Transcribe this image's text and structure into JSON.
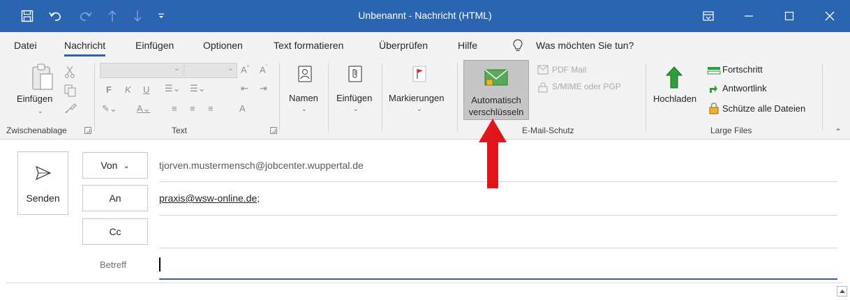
{
  "window": {
    "title": "Unbenannt - Nachricht (HTML)",
    "accent_color": "#2b64b0"
  },
  "quick_access": {
    "icons": [
      "save-icon",
      "undo-icon",
      "redo-icon",
      "up-icon",
      "down-icon",
      "customize-icon"
    ]
  },
  "tabs": {
    "items": [
      "Datei",
      "Nachricht",
      "Einfügen",
      "Optionen",
      "Text formatieren",
      "Überprüfen",
      "Hilfe"
    ],
    "active": "Nachricht",
    "tell_me": "Was möchten Sie tun?"
  },
  "ribbon": {
    "clipboard": {
      "paste_label": "Einfügen",
      "group_label": "Zwischenablage"
    },
    "text": {
      "bold": "F",
      "italic": "K",
      "underline": "U",
      "group_label": "Text"
    },
    "names": {
      "label": "Namen"
    },
    "include": {
      "label": "Einfügen"
    },
    "tags": {
      "label": "Markierungen"
    },
    "email_protection": {
      "auto_encrypt_line1": "Automatisch",
      "auto_encrypt_line2": "verschlüsseln",
      "pdf_mail": "PDF Mail",
      "smime": "S/MIME oder PGP",
      "group_label": "E-Mail-Schutz"
    },
    "large_files": {
      "upload_label": "Hochladen",
      "progress": "Fortschritt",
      "reply_link": "Antwortlink",
      "protect_all": "Schütze alle Dateien",
      "group_label": "Large Files"
    }
  },
  "compose": {
    "send_label": "Senden",
    "from_label": "Von",
    "from_value": "tjorven.mustermensch@jobcenter.wuppertal.de",
    "to_label": "An",
    "to_value": "praxis@wsw-online.de;",
    "cc_label": "Cc",
    "cc_value": "",
    "subject_label": "Betreff",
    "subject_value": ""
  },
  "annotation": {
    "arrow_color": "#e0161b"
  }
}
